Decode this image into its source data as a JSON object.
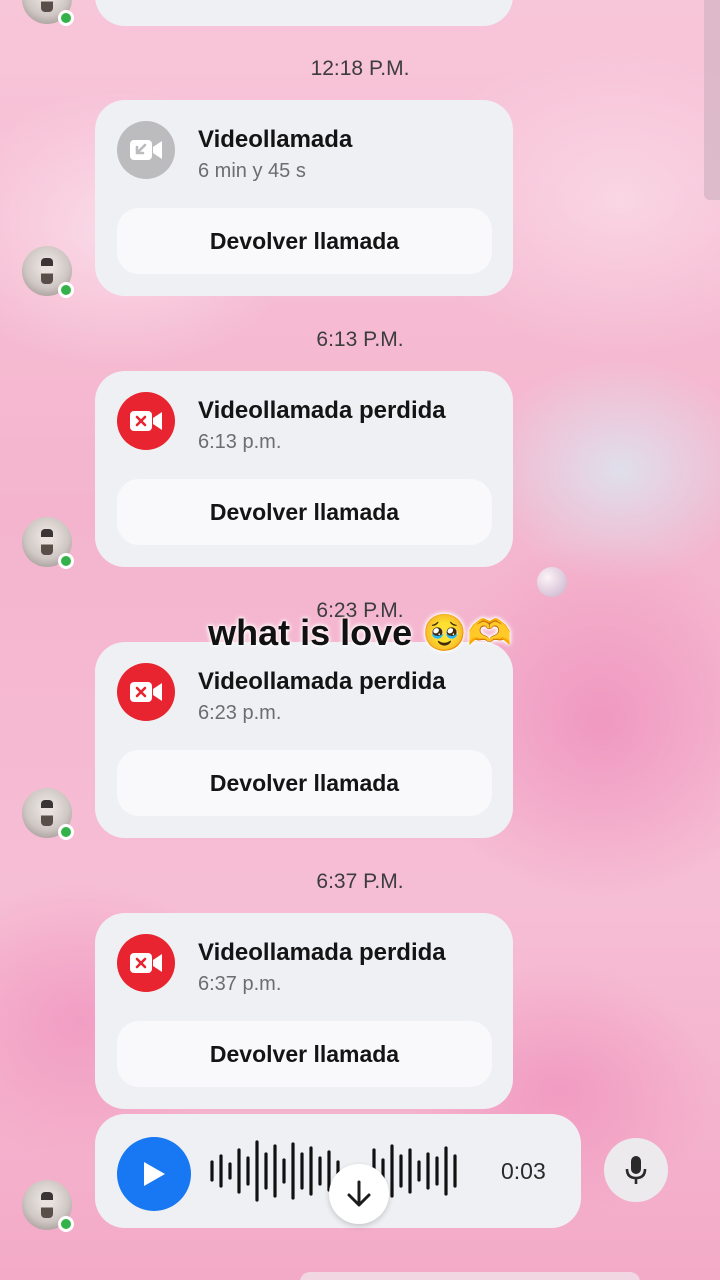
{
  "timestamps": [
    "12:18 P.M.",
    "6:13 P.M.",
    "6:23 P.M.",
    "6:37 P.M."
  ],
  "calls": [
    {
      "title": "Videollamada",
      "subtitle": "6 min y 45 s",
      "button": "Devolver llamada",
      "status": "answered",
      "icon": "video-call-incoming-icon",
      "icon_color": "#bcbcbf"
    },
    {
      "title": "Videollamada perdida",
      "subtitle": "6:13 p.m.",
      "button": "Devolver llamada",
      "status": "missed",
      "icon": "missed-video-call-icon",
      "icon_color": "#e7242f"
    },
    {
      "title": "Videollamada perdida",
      "subtitle": "6:23 p.m.",
      "button": "Devolver llamada",
      "status": "missed",
      "icon": "missed-video-call-icon",
      "icon_color": "#e7242f"
    },
    {
      "title": "Videollamada perdida",
      "subtitle": "6:37 p.m.",
      "button": "Devolver llamada",
      "status": "missed",
      "icon": "missed-video-call-icon",
      "icon_color": "#e7242f"
    }
  ],
  "caption": "what is love 🥹🫶",
  "voice_message": {
    "duration": "0:03",
    "play_color": "#1877f2"
  },
  "icons": {
    "play": "play-icon",
    "scroll_down": "arrow-down-icon",
    "mic": "microphone-icon"
  },
  "colors": {
    "accent": "#1877f2",
    "missed": "#e7242f",
    "online": "#33b24a"
  }
}
